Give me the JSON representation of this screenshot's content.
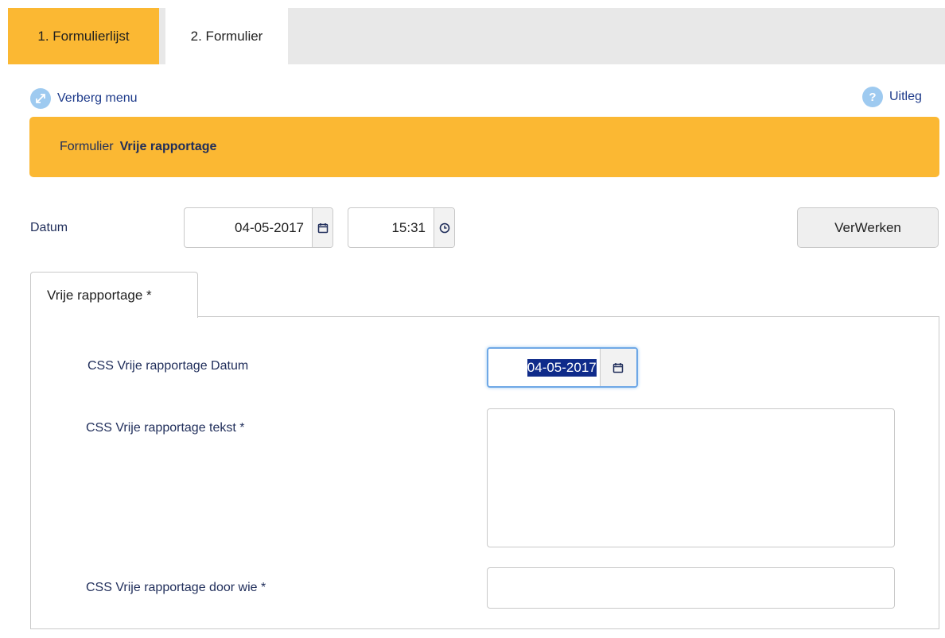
{
  "tabs": [
    {
      "label": "1. Formulierlijst"
    },
    {
      "label": "2. Formulier"
    }
  ],
  "links": {
    "hide_menu": "Verberg menu",
    "help": "Uitleg",
    "help_icon_glyph": "?"
  },
  "banner": {
    "prefix": "Formulier",
    "title": "Vrije rapportage"
  },
  "form": {
    "date_label": "Datum",
    "date_value": "04-05-2017",
    "time_value": "15:31",
    "process_button": "VerWerken"
  },
  "section": {
    "tab_label": "Vrije rapportage *",
    "fields": {
      "date_label": "CSS Vrije rapportage Datum",
      "date_value": "04-05-2017",
      "text_label": "CSS Vrije rapportage tekst *",
      "text_value": "",
      "who_label": "CSS Vrije rapportage door wie *",
      "who_value": ""
    }
  },
  "colors": {
    "accent_orange": "#fbb833",
    "link_blue": "#1d3a8a",
    "tabbar_gray": "#e8e8e8",
    "selection_blue": "#0f2b8a"
  },
  "icons": [
    "arrows-expand-icon",
    "help-icon",
    "calendar-icon",
    "clock-icon"
  ]
}
